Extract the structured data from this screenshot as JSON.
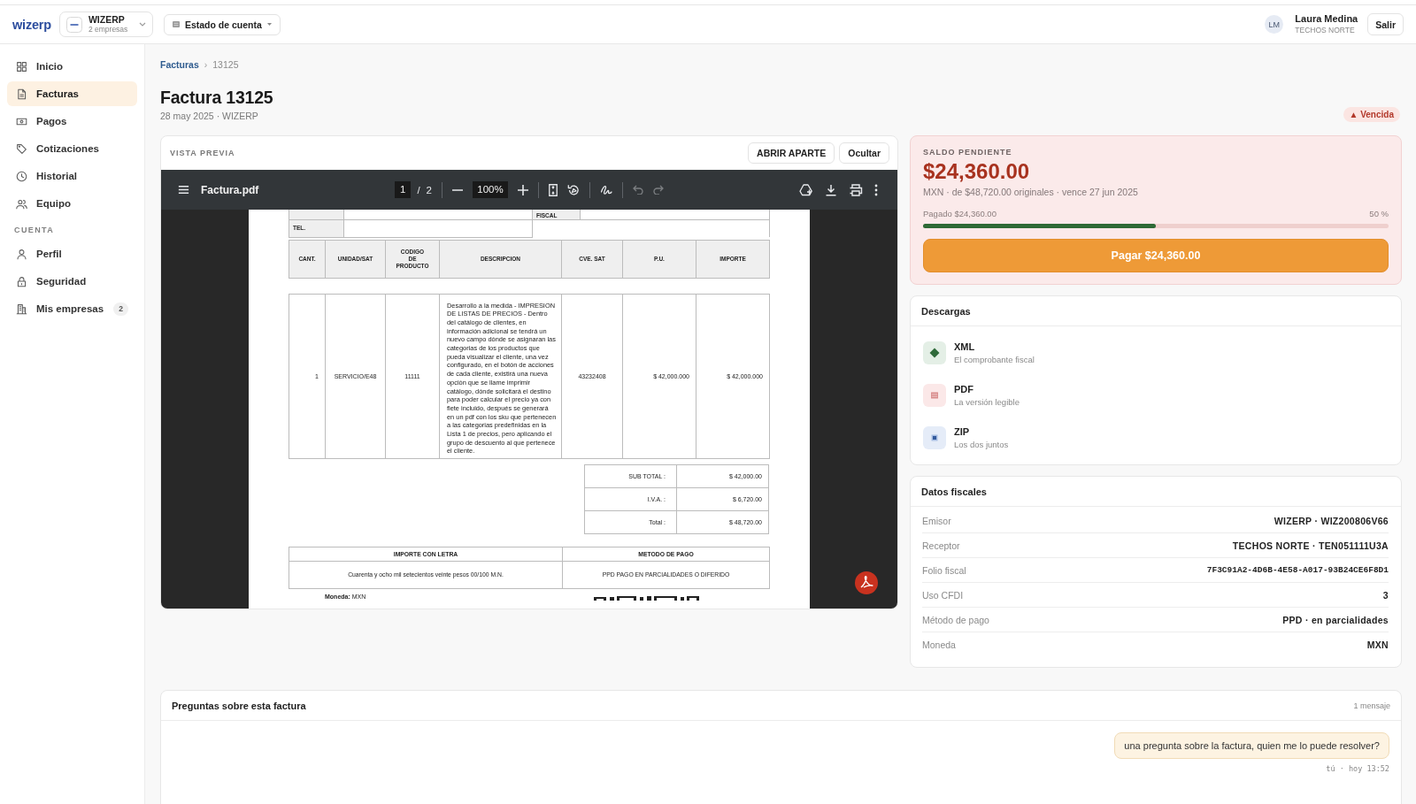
{
  "header": {
    "logo": "wizerp",
    "company": {
      "name": "WIZERP",
      "detail": "2 empresas"
    },
    "view_menu": "Estado de cuenta",
    "user": {
      "initials": "LM",
      "name": "Laura Medina",
      "company": "TECHOS NORTE"
    },
    "logout": "Salir"
  },
  "sidebar": {
    "items": [
      {
        "label": "Inicio",
        "selected": false
      },
      {
        "label": "Facturas",
        "selected": true
      },
      {
        "label": "Pagos",
        "selected": false
      },
      {
        "label": "Cotizaciones",
        "selected": false
      },
      {
        "label": "Historial",
        "selected": false
      },
      {
        "label": "Equipo",
        "selected": false
      }
    ],
    "section": "CUENTA",
    "account_items": [
      {
        "label": "Perfil",
        "selected": false
      },
      {
        "label": "Seguridad",
        "selected": false
      },
      {
        "label": "Mis empresas",
        "selected": false,
        "badge": "2"
      }
    ]
  },
  "page": {
    "breadcrumb": {
      "link": "Facturas",
      "separator": "›",
      "current": "13125"
    },
    "title": "Factura 13125",
    "subtitle": "28 may 2025 · WIZERP",
    "status": {
      "kind": "overdue",
      "label": "▲ Vencida"
    }
  },
  "preview": {
    "title": "VISTA PREVIA",
    "buttons": [
      "ABRIR APARTE",
      "Ocultar"
    ],
    "viewer": {
      "file_name": "Factura.pdf",
      "page": "1",
      "page_separator": "/",
      "page_count": "2",
      "zoom": "100%",
      "undo": {
        "disabled": true
      },
      "redo": {
        "disabled": true
      },
      "document": {
        "partial_label": "FISCAL",
        "phone_label": "TEL.",
        "columns": [
          "CANT.",
          "UNIDAD/SAT",
          "CODIGO DE PRODUCTO",
          "DESCRIPCION",
          "CVE. SAT",
          "P.U.",
          "IMPORTE"
        ],
        "items": [
          {
            "quantity": "1",
            "unit": "SERVICIO/E48",
            "product_code": "11111",
            "description": "Desarrollo a la medida - IMPRESION DE LISTAS DE PRECIOS - Dentro del catálogo de clientes, en información adicional se tendrá un nuevo campo dónde se asignaran las categorias de los productos que pueda visualizar el cliente, una vez configurado, en el botón de acciones de cada cliente, existirá una nueva opción que se llame imprimir catálogo, dónde solicitará el destino para poder calcular el precio ya con flete incluido, después se generará en un pdf con los sku que pertenecen a las categorias predefinidas en la Lista 1 de precios, pero aplicando el grupo de descuento al que pertenece el cliente.",
            "sat_code": "43232408",
            "unit_price": "$ 42,000.000",
            "amount": "$ 42,000.000"
          }
        ],
        "totals": [
          {
            "label": "SUB TOTAL :",
            "value": "$ 42,000.00"
          },
          {
            "label": "I.V.A. :",
            "value": "$ 6,720.00"
          },
          {
            "label": "Total :",
            "value": "$ 48,720.00"
          }
        ],
        "amount_in_words": {
          "heading": "IMPORTE CON LETRA",
          "text": "Cuarenta y ocho mil setecientos veinte pesos 00/100 M.N."
        },
        "payment_method": {
          "heading": "METODO DE PAGO",
          "text": "PPD PAGO EN PARCIALIDADES O DIFERIDO"
        },
        "currency": "**Moneda:** MXN"
      }
    }
  },
  "balance": {
    "label": "SALDO PENDIENTE",
    "amount": "$24,360.00",
    "detail": "MXN · de $48,720.00 originales · vence 27 jun 2025",
    "paid_label": "Pagado $24,360.00",
    "percent": "50 %",
    "level": 0.5,
    "pay_button": "Pagar $24,360.00"
  },
  "downloads": {
    "title": "Descargas",
    "items": [
      {
        "kind": "xml",
        "color": "#e4efe6",
        "label": "XML",
        "description": "El comprobante fiscal"
      },
      {
        "kind": "pdf",
        "color": "#fbe8e8",
        "label": "PDF",
        "description": "La versión legible"
      },
      {
        "kind": "zip",
        "color": "#e5ecf8",
        "label": "ZIP",
        "description": "Los dos juntos"
      }
    ]
  },
  "fiscal": {
    "title": "Datos fiscales",
    "rows": [
      {
        "kind": "text",
        "label": "Emisor",
        "value": "WIZERP · WIZ200806V66"
      },
      {
        "kind": "text",
        "label": "Receptor",
        "value": "TECHOS NORTE · TEN051111U3A"
      },
      {
        "kind": "code",
        "label": "Folio fiscal",
        "value": "7F3C91A2-4D6B-4E58-A017-93B24CE6F8D1"
      },
      {
        "kind": "text",
        "label": "Uso CFDI",
        "value": "3"
      },
      {
        "kind": "text",
        "label": "Método de pago",
        "value": "PPD · en parcialidades"
      },
      {
        "kind": "text",
        "label": "Moneda",
        "value": "MXN"
      }
    ]
  },
  "chat": {
    "title": "Preguntas sobre esta factura",
    "count": "1 mensaje",
    "messages": [
      {
        "mine": true,
        "text": "una pregunta sobre la factura, quien me lo puede resolver?",
        "meta": "tú · hoy 13:52"
      }
    ]
  }
}
